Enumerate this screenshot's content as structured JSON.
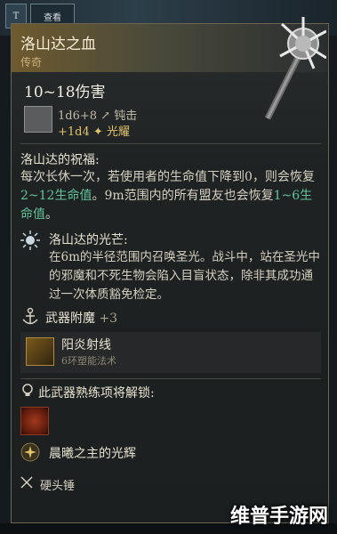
{
  "top_tabs": [
    {
      "label": "T",
      "view_label": "查看"
    }
  ],
  "item": {
    "name": "洛山达之血",
    "rarity": "传奇",
    "damage": "10~18伤害",
    "damage_detail": "1d6+8",
    "damage_type": "钝击",
    "bonus_dice": "+1d4",
    "bonus_type": "光耀"
  },
  "blessing": {
    "title": "洛山达的祝福:",
    "text_a": "每次长休一次，若使用者的生命值下降到0，则会恢复",
    "hl_a": "2~12生命值",
    "text_b": "。9m范围内的所有盟友也会恢复",
    "hl_b": "1~6生命值",
    "text_c": "。"
  },
  "radiance": {
    "title": "洛山达的光芒:",
    "text": "在6m的半径范围内召唤圣光。战斗中，站在圣光中的邪魔和不死生物会陷入目盲状态，除非其成功通过一次体质豁免检定。"
  },
  "enchant": {
    "label": "武器附魔",
    "bonus": "+3"
  },
  "spell": {
    "name": "阳炎射线",
    "sub": "6环塑能法术"
  },
  "proficiency": {
    "title": "此武器熟练项将解锁:",
    "ability": "晨曦之主的光辉",
    "weapon_type": "硬头锤"
  },
  "watermark": "维普手游网",
  "colors": {
    "highlight": "#62c39b",
    "gold": "#e3c46a",
    "rarity": "#c9b27b"
  }
}
